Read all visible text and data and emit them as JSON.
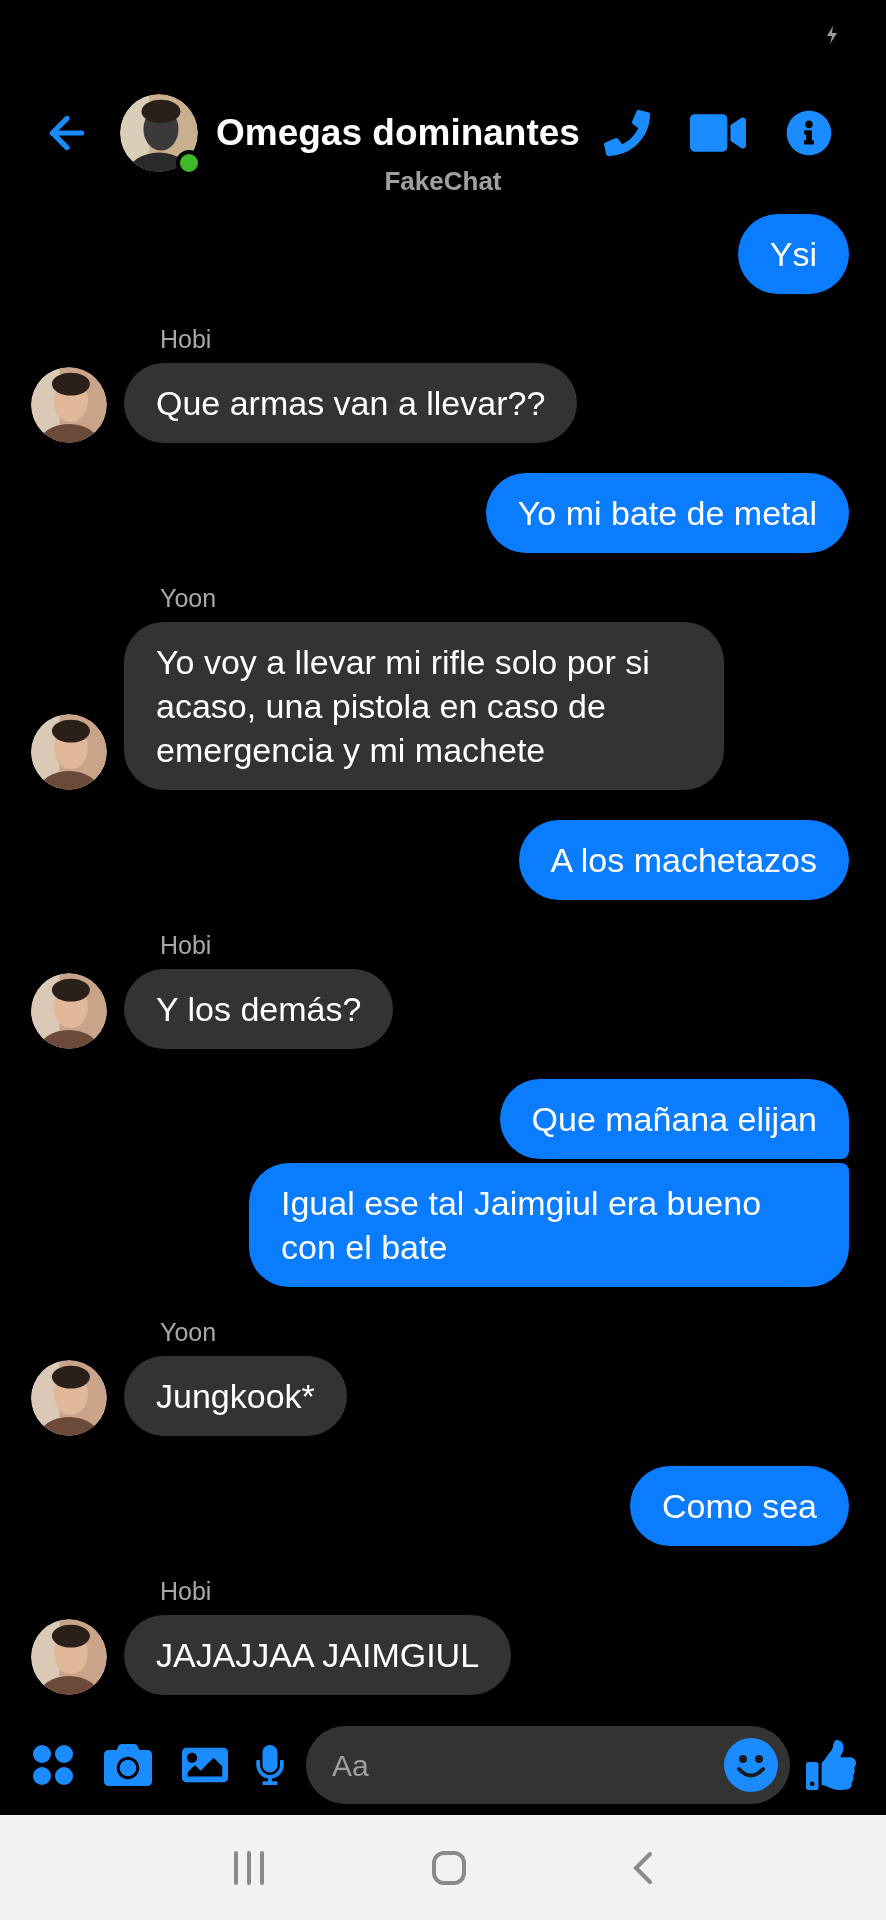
{
  "header": {
    "title": "Omegas dominantes",
    "subtitle": "FakeChat",
    "online": true
  },
  "messages": [
    {
      "kind": "outgoing",
      "text": "Ysi"
    },
    {
      "kind": "incoming",
      "sender": "Hobi",
      "text": "Que armas van a llevar??"
    },
    {
      "kind": "outgoing",
      "text": "Yo mi bate de metal"
    },
    {
      "kind": "incoming",
      "sender": "Yoon",
      "text": "Yo voy a llevar mi rifle solo por si acaso, una pistola en caso de emergencia y mi machete"
    },
    {
      "kind": "outgoing",
      "text": "A los machetazos"
    },
    {
      "kind": "incoming",
      "sender": "Hobi",
      "text": "Y los demás?"
    },
    {
      "kind": "outgoing",
      "text": "Que mañana elijan"
    },
    {
      "kind": "outgoing",
      "text": "Igual ese tal Jaimgiul era bueno con el bate"
    },
    {
      "kind": "incoming",
      "sender": "Yoon",
      "text": "Jungkook*"
    },
    {
      "kind": "outgoing",
      "text": "Como sea"
    },
    {
      "kind": "incoming",
      "sender": "Hobi",
      "text": "JAJAJJAA JAIMGIUL"
    }
  ],
  "composer": {
    "placeholder": "Aa"
  }
}
